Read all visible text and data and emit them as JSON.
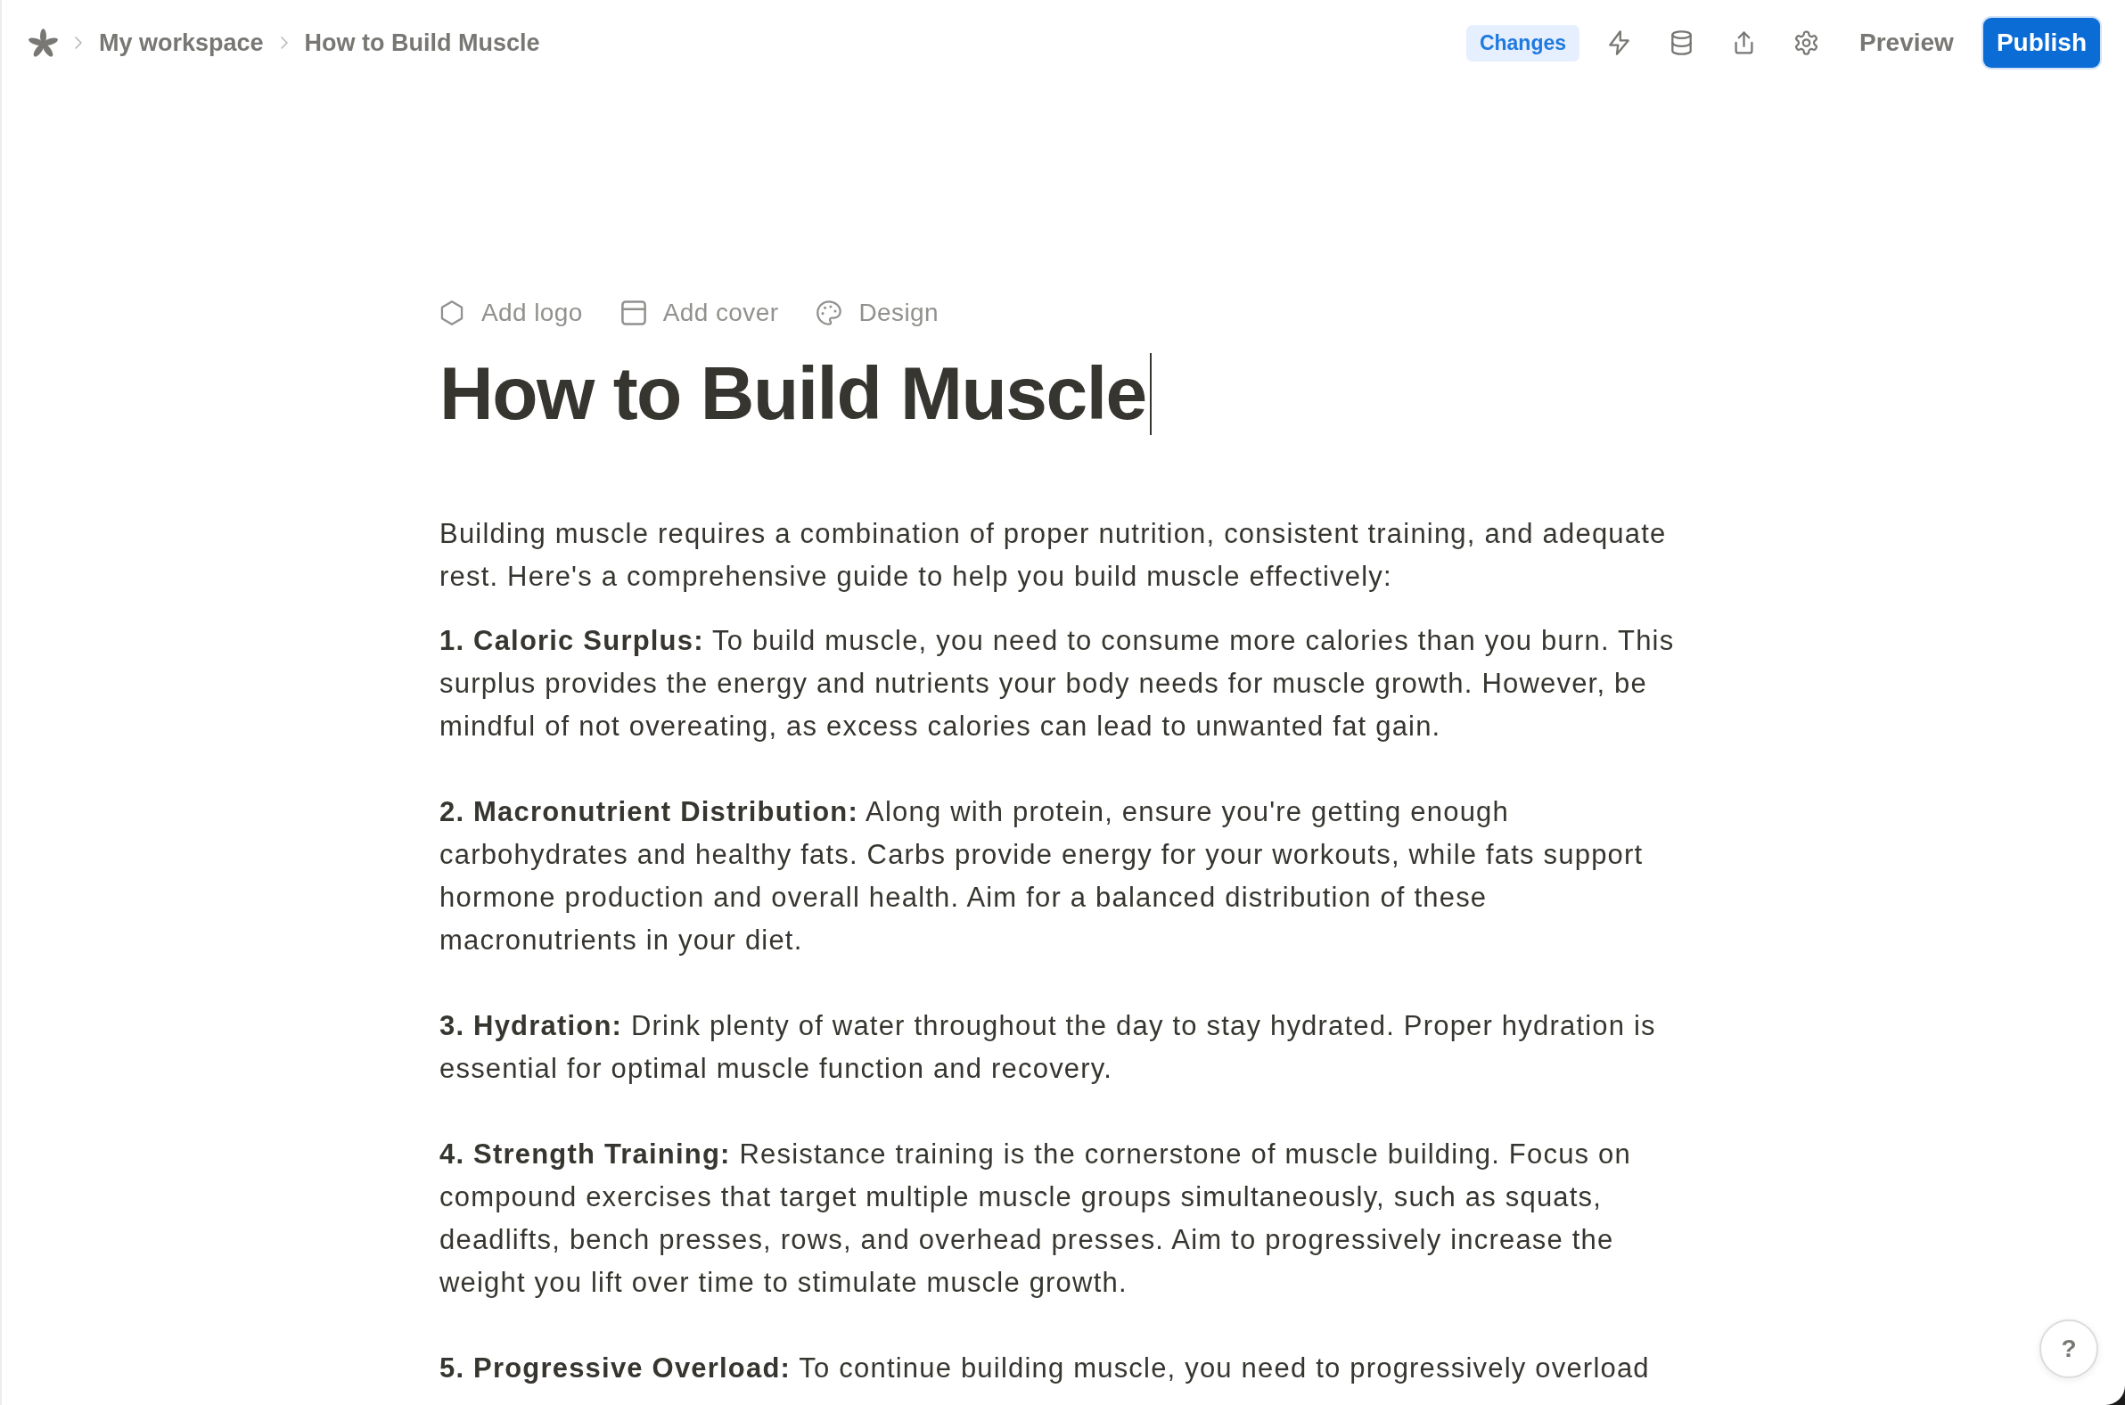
{
  "top_bar": {
    "breadcrumb": [
      "My workspace",
      "How to Build Muscle"
    ],
    "changes_button": "Changes",
    "preview_button": "Preview",
    "publish_button": "Publish"
  },
  "page_toolbar": [
    {
      "kind": "logo",
      "label": "Add logo"
    },
    {
      "kind": "cover",
      "label": "Add cover"
    },
    {
      "kind": "design",
      "label": "Design"
    }
  ],
  "page": {
    "title": "How to Build Muscle",
    "intro": "Building muscle requires a combination of proper nutrition, consistent training, and adequate rest. Here's a comprehensive guide to help you build muscle effectively:",
    "sections": [
      "**1. Caloric Surplus:** To build muscle, you need to consume more calories than you burn. This surplus provides the energy and nutrients your body needs for muscle growth. However, be mindful of not overeating, as excess calories can lead to unwanted fat gain.",
      "**2. Macronutrient Distribution:** Along with protein, ensure you're getting enough carbohydrates and healthy fats. Carbs provide energy for your workouts, while fats support hormone production and overall health. Aim for a balanced distribution of these macronutrients in your diet.",
      "**3. Hydration:** Drink plenty of water throughout the day to stay hydrated. Proper hydration is essential for optimal muscle function and recovery.",
      "**4. Strength Training:** Resistance training is the cornerstone of muscle building. Focus on compound exercises that target multiple muscle groups simultaneously, such as squats, deadlifts, bench presses, rows, and overhead presses. Aim to progressively increase the weight you lift over time to stimulate muscle growth.",
      "**5. Progressive Overload:** To continue building muscle, you need to progressively overload"
    ]
  },
  "help_button": {
    "label": "?"
  }
}
